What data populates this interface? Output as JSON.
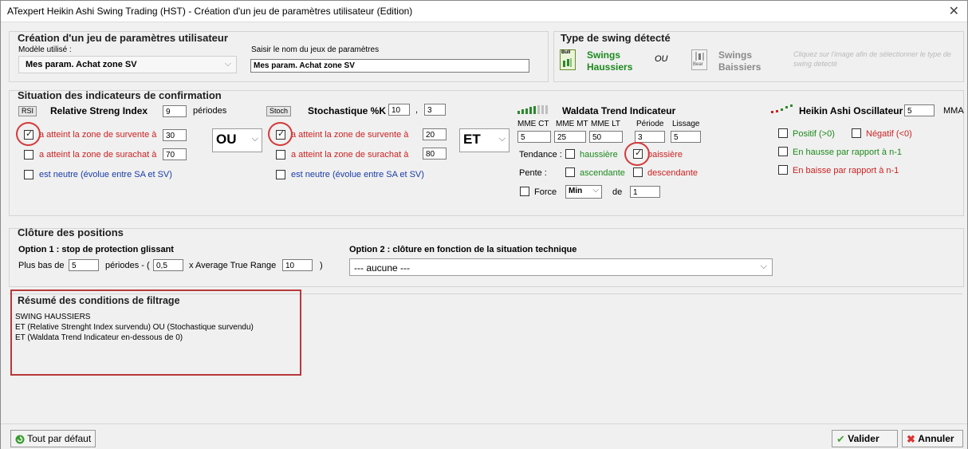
{
  "window": {
    "title": "ATexpert Heikin Ashi Swing Trading (HST) - Création d'un jeu de paramètres utilisateur (Edition)"
  },
  "creation": {
    "heading": "Création d'un jeu de paramètres utilisateur",
    "model_label": "Modèle utilisé :",
    "model_value": "Mes param. Achat zone SV",
    "name_label": "Saisir le nom du jeux de paramètres",
    "name_value": "Mes param. Achat zone SV"
  },
  "swing_type": {
    "heading": "Type de swing détecté",
    "bull_label_1": "Swings",
    "bull_label_2": "Haussiers",
    "or_label": "OU",
    "bear_label_1": "Swings",
    "bear_label_2": "Baissiers",
    "bull_icon_text": "Bull",
    "bear_icon_text": "Bear",
    "hint": "Cliquez sur l'image afin de sélectionner le type de swing detecté"
  },
  "indicators": {
    "heading": "Situation des indicateurs de confirmation",
    "rsi": {
      "tag": "RSI",
      "title": "Relative Streng Index",
      "periods_value": "9",
      "periods_label": "périodes",
      "over_sold_label": "a atteint la zone de survente à",
      "over_sold_value": "30",
      "over_sold_checked": true,
      "over_bought_label": "a atteint la zone de surachat à",
      "over_bought_value": "70",
      "over_bought_checked": false,
      "neutral_label": "est neutre (évolue entre SA et SV)",
      "neutral_checked": false
    },
    "op1": "OU",
    "stoch": {
      "tag": "Stoch",
      "title": "Stochastique %K",
      "k_value": "10",
      "comma": ",",
      "d_value": "3",
      "over_sold_label": "a atteint la zone de survente à",
      "over_sold_value": "20",
      "over_sold_checked": true,
      "over_bought_label": "a atteint la zone de surachat à",
      "over_bought_value": "80",
      "over_bought_checked": false,
      "neutral_label": "est neutre (évolue entre SA et SV)",
      "neutral_checked": false
    },
    "op2": "ET",
    "waldata": {
      "title": "Waldata Trend Indicateur",
      "col_ct": "MME CT",
      "col_mt": "MME MT",
      "col_lt": "MME LT",
      "col_period": "Période",
      "col_smooth": "Lissage",
      "val_ct": "5",
      "val_mt": "25",
      "val_lt": "50",
      "val_period": "3",
      "val_smooth": "5",
      "trend_label": "Tendance :",
      "trend_up": "haussière",
      "trend_up_checked": false,
      "trend_down": "baissière",
      "trend_down_checked": true,
      "slope_label": "Pente :",
      "slope_up": "ascendante",
      "slope_up_checked": false,
      "slope_down": "descendante",
      "slope_down_checked": false,
      "force_label": "Force",
      "force_checked": false,
      "force_select": "Min",
      "force_of": "de",
      "force_value": "1"
    },
    "heikin": {
      "title": "Heikin Ashi Oscillateur",
      "mma_value": "5",
      "mma_label": "MMA",
      "positive": "Positif (>0)",
      "negative": "Négatif (<0)",
      "rising": "En hausse par rapport à n-1",
      "falling": "En baisse par rapport à n-1"
    }
  },
  "closing": {
    "heading": "Clôture des positions",
    "opt1_title": "Option 1 : stop de protection glissant",
    "opt1_prefix": "Plus bas de",
    "opt1_low_value": "5",
    "opt1_mid": "périodes - (",
    "opt1_factor_value": "0,5",
    "opt1_atr": "x Average True Range",
    "opt1_atr_value": "10",
    "opt1_close": ")",
    "opt2_title": "Option 2 : clôture en fonction de la situation technique",
    "opt2_value": "--- aucune ---"
  },
  "summary": {
    "heading": "Résumé des conditions de filtrage",
    "lines": [
      "SWING HAUSSIERS",
      "ET  (Relative Strenght Index survendu) OU (Stochastique survendu)",
      "ET (Waldata Trend Indicateur en-dessous de 0)"
    ]
  },
  "footer": {
    "defaults": "Tout par défaut",
    "validate": "Valider",
    "cancel": "Annuler"
  },
  "colors": {
    "green_text": "#1d8a1d",
    "red_text": "#cc2222",
    "blue_text": "#1a3ca8",
    "annotation_red": "#d43a3a"
  }
}
